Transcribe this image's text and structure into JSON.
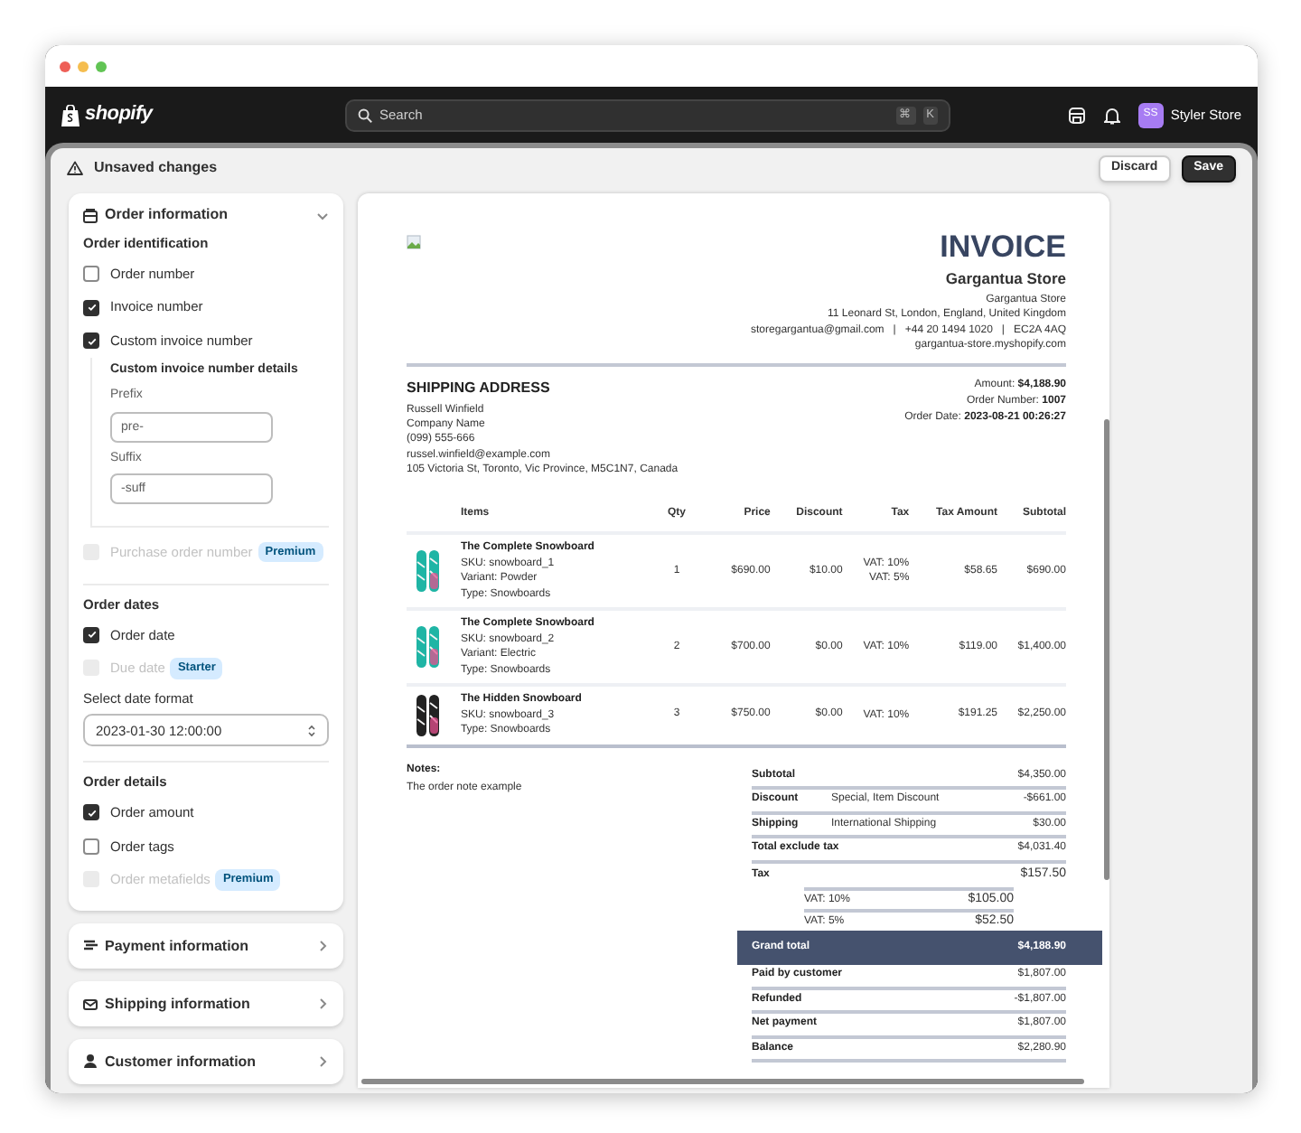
{
  "topbar": {
    "logo_text": "shopify",
    "search": {
      "placeholder": "Search",
      "keys": [
        "⌘",
        "K"
      ]
    },
    "avatar_initials": "SS",
    "store_name": "Styler Store"
  },
  "save_bar": {
    "message": "Unsaved changes",
    "buttons": [
      {
        "label": "Discard",
        "kind": "secondary"
      },
      {
        "label": "Save",
        "kind": "primary"
      }
    ]
  },
  "settings": {
    "sections": [
      {
        "title": "Order information",
        "expanded": true,
        "groups": [
          {
            "title": "Order identification",
            "items": [
              {
                "kind": "checkbox",
                "label": "Order number",
                "checked": false,
                "disabled": false
              },
              {
                "kind": "checkbox",
                "label": "Invoice number",
                "checked": true,
                "disabled": false
              },
              {
                "kind": "checkbox",
                "label": "Custom invoice number",
                "checked": true,
                "disabled": false
              },
              {
                "kind": "details",
                "title": "Custom invoice number details",
                "fields": [
                  {
                    "label": "Prefix",
                    "value": "pre-"
                  },
                  {
                    "label": "Suffix",
                    "value": "-suff"
                  }
                ]
              },
              {
                "kind": "checkbox",
                "label": "Purchase order number",
                "checked": false,
                "disabled": true,
                "badge": "Premium"
              }
            ]
          },
          {
            "title": "Order dates",
            "items": [
              {
                "kind": "checkbox",
                "label": "Order date",
                "checked": true,
                "disabled": false
              },
              {
                "kind": "checkbox",
                "label": "Due date",
                "checked": false,
                "disabled": true,
                "badge": "Starter"
              },
              {
                "kind": "select",
                "label": "Select date format",
                "value": "2023-01-30 12:00:00"
              }
            ]
          },
          {
            "title": "Order details",
            "items": [
              {
                "kind": "checkbox",
                "label": "Order amount",
                "checked": true,
                "disabled": false
              },
              {
                "kind": "checkbox",
                "label": "Order tags",
                "checked": false,
                "disabled": false
              },
              {
                "kind": "checkbox",
                "label": "Order metafields",
                "checked": false,
                "disabled": true,
                "badge": "Premium"
              }
            ]
          }
        ]
      },
      {
        "title": "Payment information",
        "expanded": false
      },
      {
        "title": "Shipping information",
        "expanded": false
      },
      {
        "title": "Customer information",
        "expanded": false
      }
    ]
  },
  "invoice": {
    "title": "INVOICE",
    "store_name": "Gargantua Store",
    "store_lines": [
      "Gargantua Store",
      "11 Leonard St, London, England, United Kingdom",
      "storegargantua@gmail.com   |   +44 20 1494 1020   |   EC2A 4AQ",
      "gargantua-store.myshopify.com"
    ],
    "shipping": {
      "heading": "SHIPPING ADDRESS",
      "lines": [
        "Russell Winfield",
        "Company Name",
        "(099) 555-666",
        "russel.winfield@example.com",
        "105 Victoria St, Toronto, Vic Province, M5C1N7, Canada"
      ]
    },
    "meta": [
      {
        "label": "Amount:",
        "value": "$4,188.90"
      },
      {
        "label": "Order Number:",
        "value": "1007"
      },
      {
        "label": "Order Date:",
        "value": "2023-08-21 00:26:27"
      }
    ],
    "columns": [
      "Items",
      "Qty",
      "Price",
      "Discount",
      "Tax",
      "Tax Amount",
      "Subtotal"
    ],
    "rows": [
      {
        "name": "The Complete Snowboard",
        "details": [
          "SKU: snowboard_1",
          "Variant: Powder",
          "Type: Snowboards"
        ],
        "qty": "1",
        "price": "$690.00",
        "discount": "$10.00",
        "tax": [
          "VAT: 10%",
          "VAT: 5%"
        ],
        "tax_amount": "$58.65",
        "subtotal": "$690.00",
        "color": "#1fb5a5"
      },
      {
        "name": "The Complete Snowboard",
        "details": [
          "SKU: snowboard_2",
          "Variant: Electric",
          "Type: Snowboards"
        ],
        "qty": "2",
        "price": "$700.00",
        "discount": "$0.00",
        "tax": [
          "VAT: 10%"
        ],
        "tax_amount": "$119.00",
        "subtotal": "$1,400.00",
        "color": "#1fb5a5"
      },
      {
        "name": "The Hidden Snowboard",
        "details": [
          "SKU: snowboard_3",
          "Type: Snowboards"
        ],
        "qty": "3",
        "price": "$750.00",
        "discount": "$0.00",
        "tax": [
          "VAT: 10%"
        ],
        "tax_amount": "$191.25",
        "subtotal": "$2,250.00",
        "color": "#222222"
      }
    ],
    "notes": {
      "label": "Notes:",
      "text": "The order note example"
    },
    "totals": [
      {
        "kind": "line",
        "label": "Subtotal",
        "value": "$4,350.00"
      },
      {
        "kind": "line",
        "label": "Discount",
        "detail": "Special, Item Discount",
        "value": "-$661.00"
      },
      {
        "kind": "line",
        "label": "Shipping",
        "detail": "International Shipping",
        "value": "$30.00"
      },
      {
        "kind": "line",
        "label": "Total exclude tax",
        "value": "$4,031.40"
      },
      {
        "kind": "tax",
        "label": "Tax",
        "value": "$157.50"
      },
      {
        "kind": "tax_line",
        "label": "VAT: 10%",
        "value": "$105.00"
      },
      {
        "kind": "tax_line",
        "label": "VAT: 5%",
        "value": "$52.50"
      },
      {
        "kind": "grand",
        "label": "Grand total",
        "value": "$4,188.90"
      },
      {
        "kind": "line",
        "label": "Paid by customer",
        "value": "$1,807.00"
      },
      {
        "kind": "line",
        "label": "Refunded",
        "value": "-$1,807.00"
      },
      {
        "kind": "line",
        "label": "Net payment",
        "value": "$1,807.00"
      },
      {
        "kind": "line",
        "label": "Balance",
        "value": "$2,280.90"
      }
    ]
  }
}
